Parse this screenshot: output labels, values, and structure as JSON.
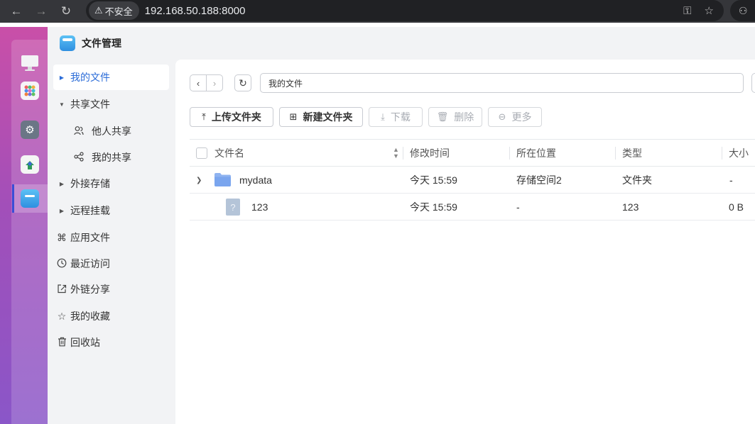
{
  "browser": {
    "security_label": "不安全",
    "url": "192.168.50.188:8000"
  },
  "app": {
    "title": "文件管理"
  },
  "sidebar": {
    "items": [
      {
        "label": "我的文件",
        "icon": "caret-right-icon",
        "active": true
      },
      {
        "label": "共享文件",
        "icon": "caret-down-icon"
      },
      {
        "label": "他人共享",
        "icon": "users-icon"
      },
      {
        "label": "我的共享",
        "icon": "share-icon"
      },
      {
        "label": "外接存储",
        "icon": "caret-right-icon"
      },
      {
        "label": "远程挂载",
        "icon": "caret-right-icon"
      },
      {
        "label": "应用文件",
        "icon": "command-icon"
      },
      {
        "label": "最近访问",
        "icon": "clock-icon"
      },
      {
        "label": "外链分享",
        "icon": "external-share-icon"
      },
      {
        "label": "我的收藏",
        "icon": "star-icon"
      },
      {
        "label": "回收站",
        "icon": "trash-icon"
      }
    ]
  },
  "pathbar": {
    "path": "我的文件"
  },
  "toolbar": {
    "upload": "上传文件夹",
    "new_folder": "新建文件夹",
    "download": "下载",
    "delete": "删除",
    "more": "更多"
  },
  "table": {
    "columns": [
      "文件名",
      "修改时间",
      "所在位置",
      "类型",
      "大小"
    ],
    "rows": [
      {
        "name": "mydata",
        "modified": "今天 15:59",
        "location": "存储空间2",
        "type": "文件夹",
        "size": "-"
      },
      {
        "name": "123",
        "modified": "今天 15:59",
        "location": "-",
        "type": "123",
        "size": "0 B"
      }
    ]
  },
  "colors": {
    "accent": "#2b6cd8",
    "dock_top": "#c94fa8",
    "dock_bottom": "#8a56c8"
  }
}
